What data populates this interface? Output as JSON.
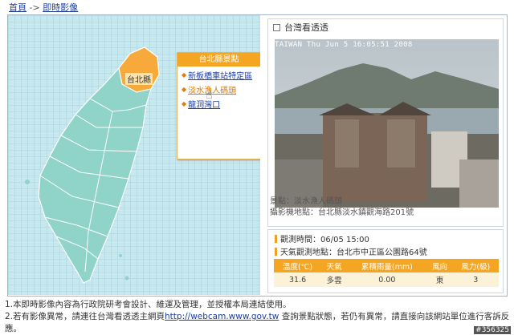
{
  "breadcrumb": {
    "home": "首頁",
    "sep": " -> ",
    "current": "即時影像"
  },
  "map": {
    "county_label": "台北縣",
    "popup_title": "台北縣景點",
    "items": [
      {
        "label": "新板橋車站特定區"
      },
      {
        "label": "淡水漁人碼頭"
      },
      {
        "label": "龍洞灣口"
      }
    ]
  },
  "camera": {
    "header": "台灣看透透",
    "caption": "TAIWAN  Thu Jun  5 16:05:51 2008",
    "scene_label": "景點：淡水漁人碼頭",
    "location_label": "攝影機地點：台北縣淡水鎮觀海路201號"
  },
  "observation": {
    "time_label": "觀測時間",
    "time_value": "：06/05 15:00",
    "station_label": "天氣觀測地點",
    "station_value": "：台北市中正區公園路64號",
    "headers": [
      "溫度(℃)",
      "天氣",
      "累積雨量(mm)",
      "風向",
      "風力(級)"
    ],
    "values": [
      "31.6",
      "多雲",
      "0.00",
      "東",
      "3"
    ]
  },
  "notes": {
    "line1": "1.本即時影像內容為行政院研考會設計、維運及管理，並授權本局連結使用。",
    "line2_pre": "2.若有影像異常，請連往台灣看透透主網頁",
    "line2_link": "http://webcam.www.gov.tw",
    "line2_post": " 查詢景點狀態，若仍有異常，請直接向該網站單位進行客訴反應。"
  },
  "watermark": "#356325",
  "colors": {
    "accent": "#f4a623",
    "map_fill": "#8fd3c9",
    "link": "#1f3f9f"
  }
}
